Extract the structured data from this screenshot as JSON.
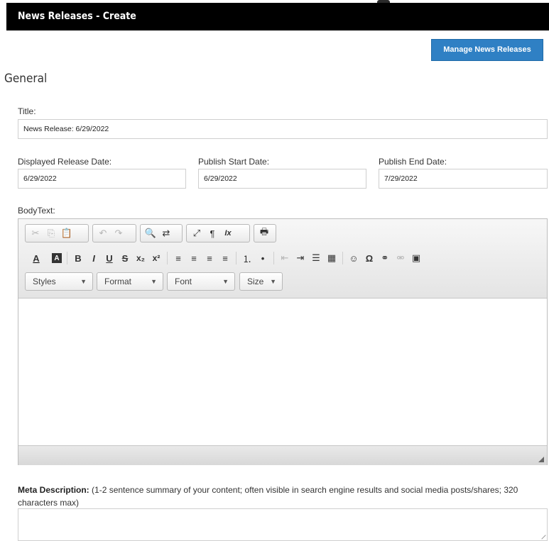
{
  "header": {
    "title": "News Releases - Create"
  },
  "actions": {
    "manage_label": "Manage News Releases"
  },
  "section": {
    "heading": "General"
  },
  "fields": {
    "title": {
      "label": "Title:",
      "value": "News Release: 6/29/2022"
    },
    "displayed_date": {
      "label": "Displayed Release Date:",
      "value": "6/29/2022"
    },
    "publish_start": {
      "label": "Publish Start Date:",
      "value": "6/29/2022"
    },
    "publish_end": {
      "label": "Publish End Date:",
      "value": "7/29/2022"
    },
    "body": {
      "label": "BodyText:"
    }
  },
  "editor": {
    "combos": {
      "styles": "Styles",
      "format": "Format",
      "font": "Font",
      "size": "Size"
    },
    "icons": {
      "cut": "✂",
      "copy": "⎘",
      "paste": "📋",
      "undo": "↶",
      "redo": "↷",
      "find": "🔍",
      "replace": "⇄",
      "maximize": "⤢",
      "showblocks": "¶",
      "removeformat": "Ix",
      "print": "🖶",
      "textcolor": "A",
      "bgcolor": "A",
      "bold": "B",
      "italic": "I",
      "underline": "U",
      "strike": "S",
      "subscript": "x₂",
      "superscript": "x²",
      "align_left": "≡",
      "align_center": "≡",
      "align_right": "≡",
      "justify": "≡",
      "numbered_list": "⒈",
      "bulleted_list": "•",
      "outdent": "⇤",
      "indent": "⇥",
      "hline": "☰",
      "table": "▦",
      "smiley": "☺",
      "special_char": "Ω",
      "link": "⚭",
      "unlink": "⚮",
      "image": "▣"
    }
  },
  "meta": {
    "label": "Meta Description:",
    "hint": "(1-2 sentence summary of your content; often visible in search engine results and social media posts/shares; 320 characters max)"
  }
}
